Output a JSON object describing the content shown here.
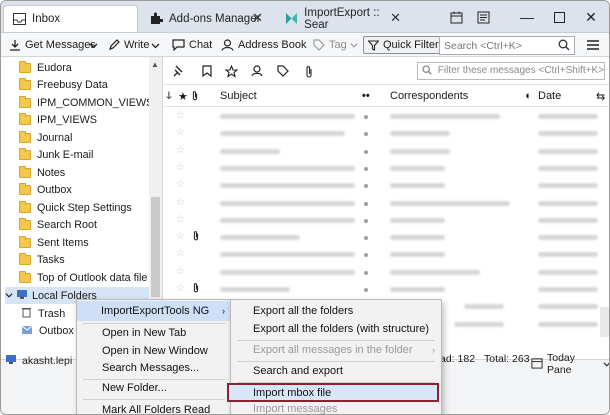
{
  "tabs": [
    {
      "label": "Inbox"
    },
    {
      "label": "Add-ons Manager"
    },
    {
      "label": "ImportExport :: Sear"
    }
  ],
  "toolbar": {
    "get_messages": "Get Messages",
    "write": "Write",
    "chat": "Chat",
    "address_book": "Address Book",
    "tag": "Tag",
    "quick_filter": "Quick Filter",
    "search_placeholder": "Search <Ctrl+K>"
  },
  "folders": {
    "items": [
      "Eudora",
      "Freebusy Data",
      "IPM_COMMON_VIEWS",
      "IPM_VIEWS",
      "Journal",
      "Junk E-mail",
      "Notes",
      "Outbox",
      "Quick Step Settings",
      "Search Root",
      "Sent Items",
      "Tasks",
      "Top of Outlook data file"
    ],
    "local_folders": "Local Folders",
    "trash": "Trash",
    "outbox": "Outbox",
    "account": "akasht.lepi"
  },
  "message_list": {
    "filter_placeholder": "Filter these messages <Ctrl+Shift+K>",
    "columns": {
      "subject": "Subject",
      "correspondents": "Correspondents",
      "date": "Date"
    }
  },
  "status": {
    "read": "ad: 182",
    "total": "Total: 263",
    "today_pane": "Today Pane"
  },
  "context_menu": {
    "items": [
      "ImportExportTools NG",
      "Open in New Tab",
      "Open in New Window",
      "Search Messages...",
      "New Folder...",
      "Mark All Folders Read"
    ]
  },
  "submenu": {
    "items": [
      "Export all the folders",
      "Export all the folders (with structure)",
      "Export all messages in the folder",
      "Search and export",
      "Import mbox file",
      "Import messages"
    ]
  },
  "colors": {
    "accent": "#8b2332",
    "highlight": "#cde0f7"
  }
}
